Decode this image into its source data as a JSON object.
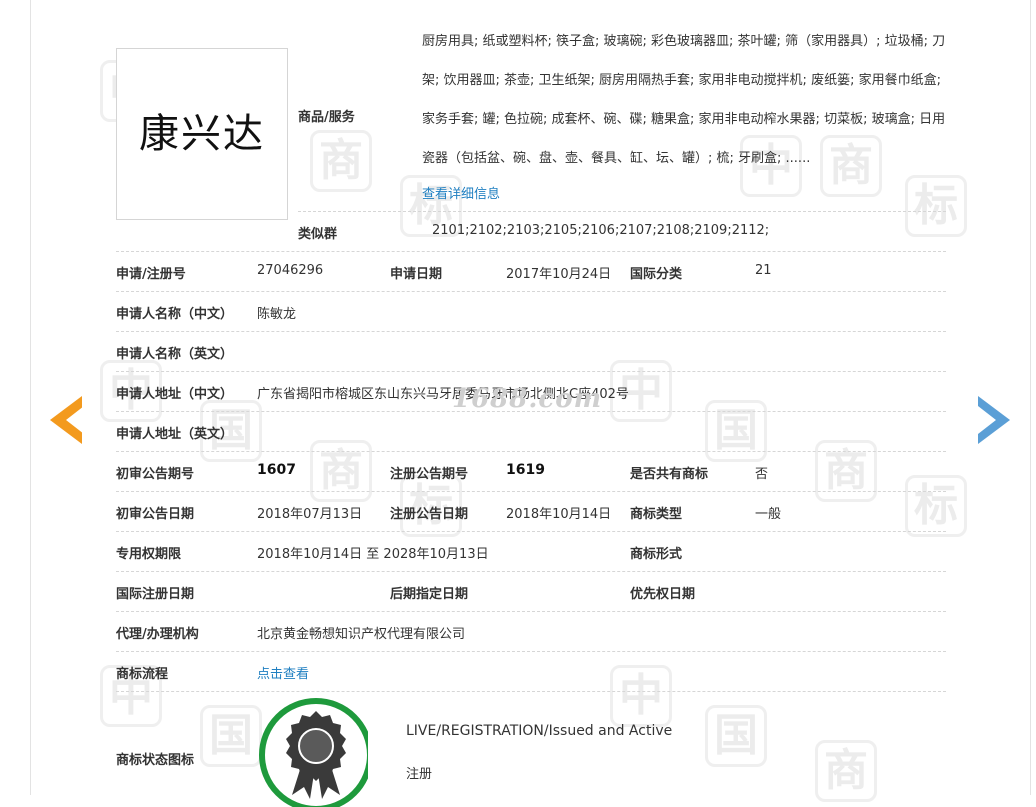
{
  "logo": {
    "text": "康兴达"
  },
  "goods": {
    "label": "商品/服务",
    "text": "厨房用具; 纸或塑料杯; 筷子盒; 玻璃碗; 彩色玻璃器皿; 茶叶罐; 筛（家用器具）; 垃圾桶; 刀架; 饮用器皿; 茶壶; 卫生纸架; 厨房用隔热手套; 家用非电动搅拌机; 废纸篓; 家用餐巾纸盒; 家务手套; 罐; 色拉碗; 成套杯、碗、碟; 糖果盒; 家用非电动榨水果器; 切菜板; 玻璃盒; 日用瓷器（包括盆、碗、盘、壶、餐具、缸、坛、罐）; 梳; 牙刷盒; ......",
    "detail_link": "查看详细信息"
  },
  "similar_group": {
    "label": "类似群",
    "value": "2101;2102;2103;2105;2106;2107;2108;2109;2112;"
  },
  "rows": {
    "reg_no": {
      "label": "申请/注册号",
      "value": "27046296"
    },
    "app_date": {
      "label": "申请日期",
      "value": "2017年10月24日"
    },
    "intl_class": {
      "label": "国际分类",
      "value": "21"
    },
    "applicant_cn": {
      "label": "申请人名称（中文）",
      "value": "陈敏龙"
    },
    "applicant_en": {
      "label": "申请人名称（英文）",
      "value": ""
    },
    "address_cn": {
      "label": "申请人地址（中文）",
      "value": "广东省揭阳市榕城区东山东兴马牙居委马牙市场北侧北C座402号"
    },
    "address_en": {
      "label": "申请人地址（英文）",
      "value": ""
    },
    "prelim_no": {
      "label": "初审公告期号",
      "value": "1607"
    },
    "reg_pub_no": {
      "label": "注册公告期号",
      "value": "1619"
    },
    "shared": {
      "label": "是否共有商标",
      "value": "否"
    },
    "prelim_date": {
      "label": "初审公告日期",
      "value": "2018年07月13日"
    },
    "reg_pub_date": {
      "label": "注册公告日期",
      "value": "2018年10月14日"
    },
    "tm_type": {
      "label": "商标类型",
      "value": "一般"
    },
    "exclusive_period": {
      "label": "专用权期限",
      "value": "2018年10月14日 至 2028年10月13日"
    },
    "tm_form": {
      "label": "商标形式",
      "value": ""
    },
    "intl_reg_date": {
      "label": "国际注册日期",
      "value": ""
    },
    "later_date": {
      "label": "后期指定日期",
      "value": ""
    },
    "priority_date": {
      "label": "优先权日期",
      "value": ""
    },
    "agent": {
      "label": "代理/办理机构",
      "value": "北京黄金畅想知识产权代理有限公司"
    },
    "process": {
      "label": "商标流程",
      "value": "点击查看"
    },
    "status_icon": {
      "label": "商标状态图标"
    }
  },
  "status": {
    "en": "LIVE/REGISTRATION/Issued and Active",
    "cn": "注册"
  },
  "watermark": {
    "site": "1688.com"
  },
  "colors": {
    "link": "#1f7fc1",
    "prev_arrow": "#f39a1e",
    "next_arrow": "#5b9fd6",
    "badge_ring": "#1e9a3c"
  }
}
